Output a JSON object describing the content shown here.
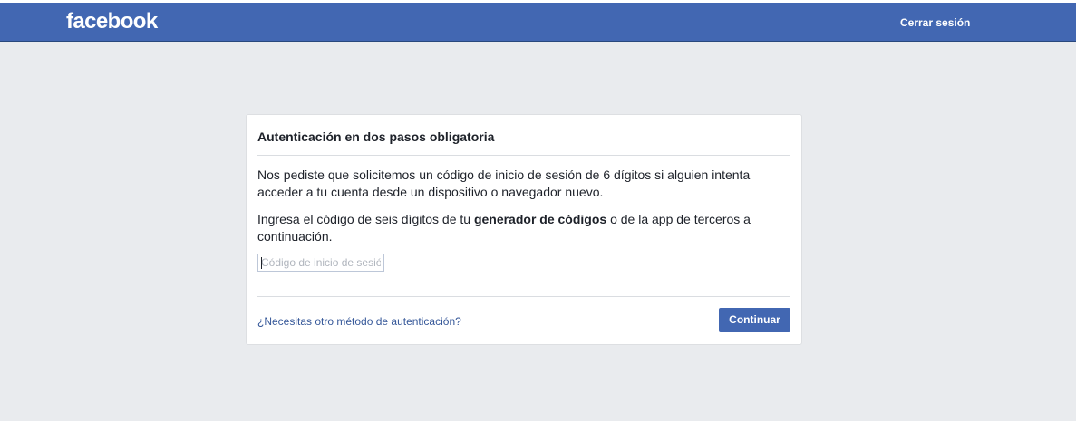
{
  "header": {
    "logo_text": "facebook",
    "logout_label": "Cerrar sesión"
  },
  "card": {
    "title": "Autenticación en dos pasos obligatoria",
    "paragraph1": "Nos pediste que solicitemos un código de inicio de sesión de 6 dígitos si alguien intenta acceder a tu cuenta desde un dispositivo o navegador nuevo.",
    "paragraph2_before": "Ingresa el código de seis dígitos de tu ",
    "paragraph2_bold": "generador de códigos",
    "paragraph2_after": " o de la app de terceros a continuación.",
    "code_input": {
      "placeholder": "Código de inicio de sesión",
      "value": ""
    },
    "alt_method_link": "¿Necesitas otro método de autenticación?",
    "continue_label": "Continuar"
  },
  "colors": {
    "brand_blue": "#4267b2",
    "page_background": "#e9ebee",
    "link_blue": "#365899"
  }
}
